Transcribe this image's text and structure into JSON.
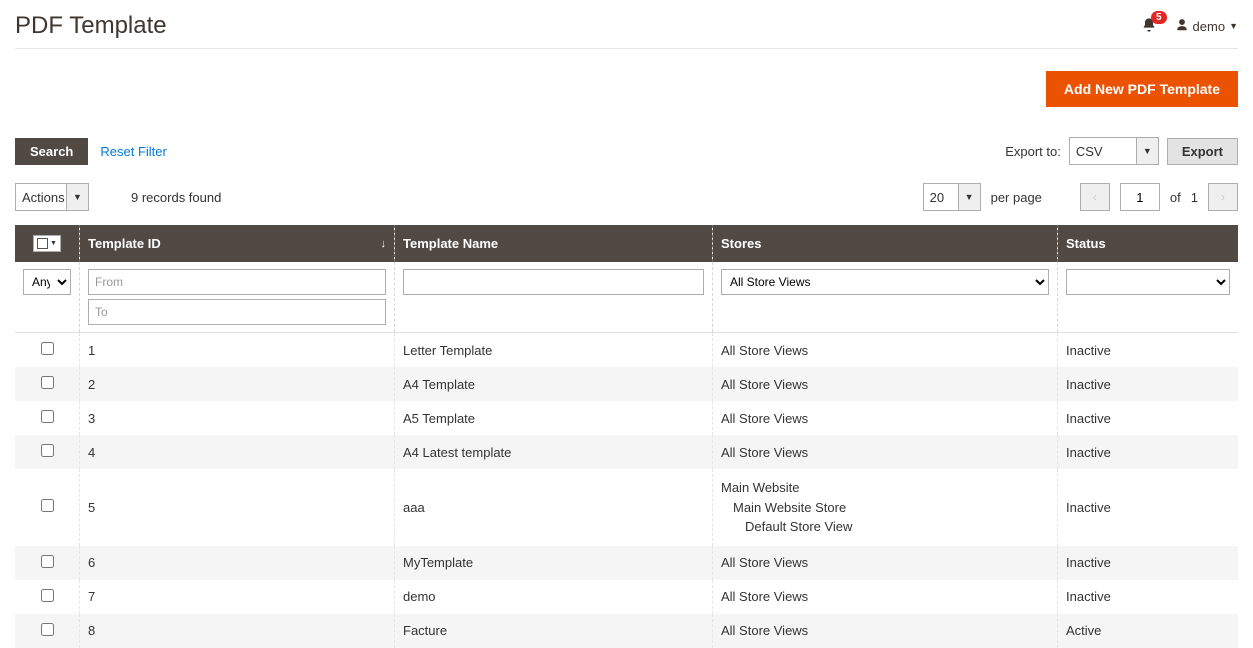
{
  "header": {
    "title": "PDF Template",
    "notification_count": "5",
    "username": "demo"
  },
  "actions": {
    "add_button": "Add New PDF Template"
  },
  "toolbar": {
    "search_btn": "Search",
    "reset_filter": "Reset Filter",
    "export_to_label": "Export to:",
    "export_format": "CSV",
    "export_btn": "Export",
    "actions_label": "Actions",
    "records_found": "9 records found",
    "page_size": "20",
    "per_page_label": "per page",
    "current_page": "1",
    "of_label": "of",
    "total_pages": "1"
  },
  "columns": {
    "template_id": "Template ID",
    "template_name": "Template Name",
    "stores": "Stores",
    "status": "Status"
  },
  "filters": {
    "any_option": "Any",
    "from_placeholder": "From",
    "to_placeholder": "To",
    "stores_default": "All Store Views"
  },
  "rows": [
    {
      "id": "1",
      "name": "Letter Template",
      "stores": [
        "All Store Views"
      ],
      "status": "Inactive"
    },
    {
      "id": "2",
      "name": "A4 Template",
      "stores": [
        "All Store Views"
      ],
      "status": "Inactive"
    },
    {
      "id": "3",
      "name": "A5 Template",
      "stores": [
        "All Store Views"
      ],
      "status": "Inactive"
    },
    {
      "id": "4",
      "name": "A4 Latest template",
      "stores": [
        "All Store Views"
      ],
      "status": "Inactive"
    },
    {
      "id": "5",
      "name": "aaa",
      "stores": [
        "Main Website",
        "Main Website Store",
        "Default Store View"
      ],
      "status": "Inactive"
    },
    {
      "id": "6",
      "name": "MyTemplate",
      "stores": [
        "All Store Views"
      ],
      "status": "Inactive"
    },
    {
      "id": "7",
      "name": "demo",
      "stores": [
        "All Store Views"
      ],
      "status": "Inactive"
    },
    {
      "id": "8",
      "name": "Facture",
      "stores": [
        "All Store Views"
      ],
      "status": "Active"
    }
  ]
}
